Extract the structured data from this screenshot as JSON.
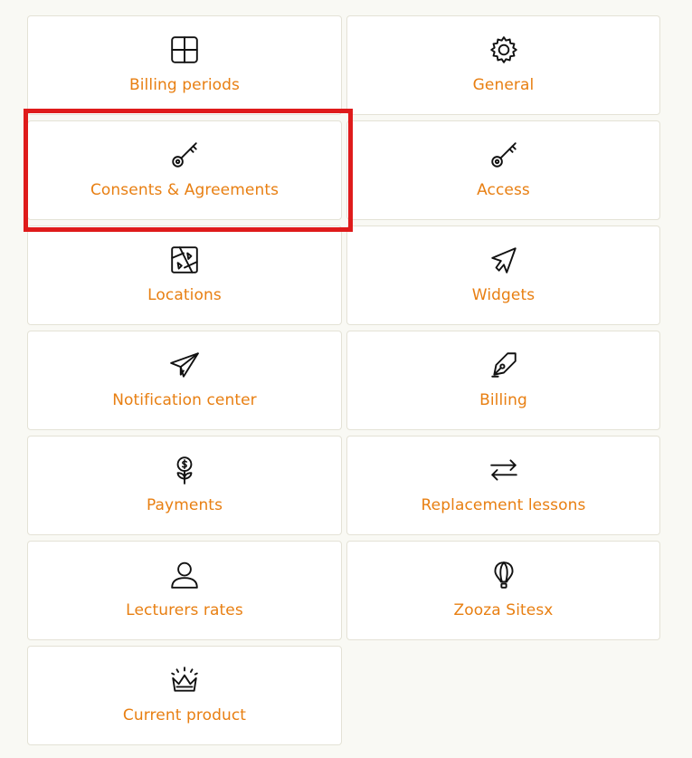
{
  "tiles": [
    {
      "label": "Billing periods",
      "icon": "grid-icon"
    },
    {
      "label": "General",
      "icon": "gear-icon"
    },
    {
      "label": "Consents & Agreements",
      "icon": "key-icon"
    },
    {
      "label": "Access",
      "icon": "key-icon"
    },
    {
      "label": "Locations",
      "icon": "map-icon"
    },
    {
      "label": "Widgets",
      "icon": "cursor-arrow-icon"
    },
    {
      "label": "Notification center",
      "icon": "paper-plane-icon"
    },
    {
      "label": "Billing",
      "icon": "pen-nib-icon"
    },
    {
      "label": "Payments",
      "icon": "money-plant-icon"
    },
    {
      "label": "Replacement lessons",
      "icon": "swap-arrows-icon"
    },
    {
      "label": "Lecturers rates",
      "icon": "user-icon"
    },
    {
      "label": "Zooza Sitesx",
      "icon": "hot-air-balloon-icon"
    },
    {
      "label": "Current product",
      "icon": "crown-icon"
    }
  ],
  "highlight": {
    "target": "Consents & Agreements",
    "color": "#df1b1b"
  },
  "colors": {
    "label": "#e87f12",
    "background": "#f9f9f4",
    "tile": "#ffffff",
    "border": "#e4e2d6"
  }
}
